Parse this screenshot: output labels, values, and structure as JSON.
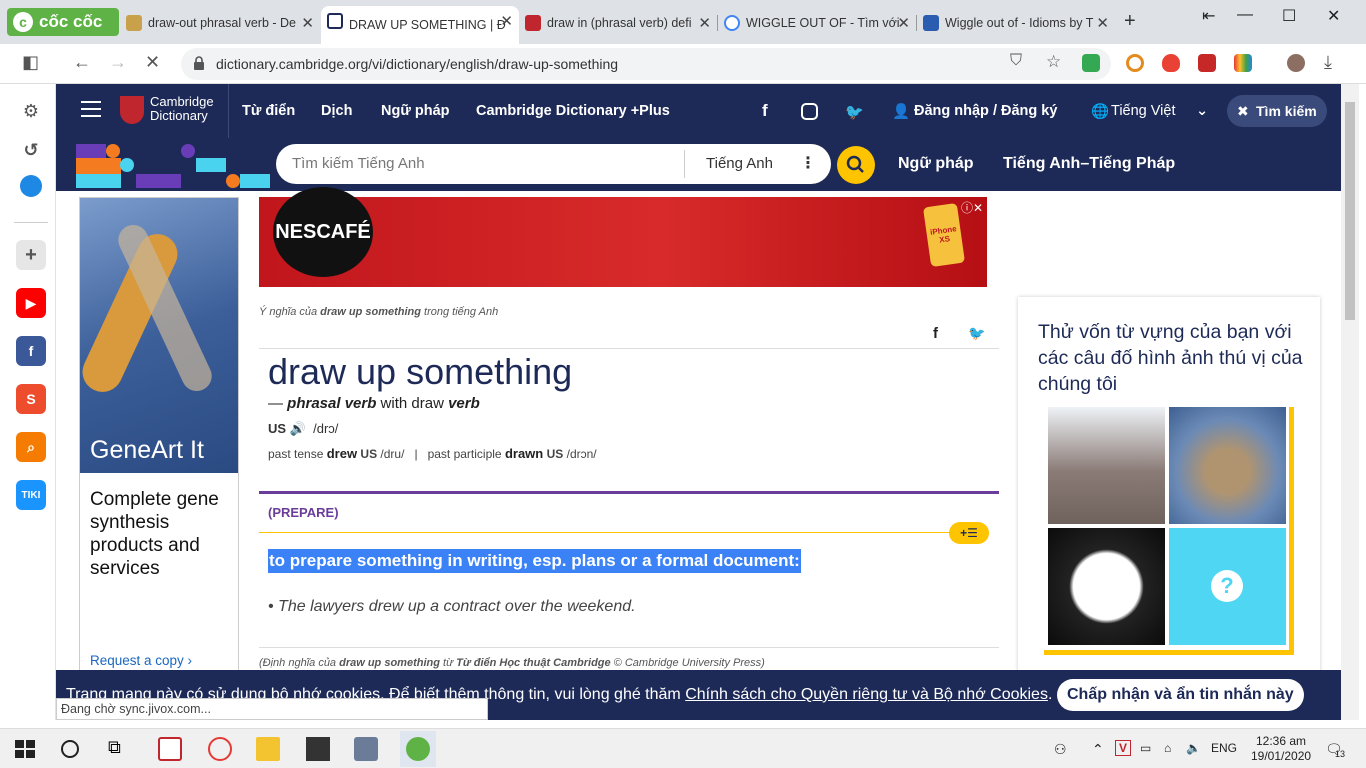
{
  "browser": {
    "logo": "cốc cốc",
    "tabs": [
      {
        "title": "draw-out phrasal verb - De",
        "favicon_color": "#8a6d3b"
      },
      {
        "title": "DRAW UP SOMETHING | Đ",
        "favicon_color": "#1d2a57"
      },
      {
        "title": "draw in (phrasal verb) defi",
        "favicon_color": "#c0262d"
      },
      {
        "title": "WIGGLE OUT OF - Tìm với",
        "favicon_color": "#4285f4"
      },
      {
        "title": "Wiggle out of - Idioms by T",
        "favicon_color": "#2a5db0"
      }
    ],
    "url": "dictionary.cambridge.org/vi/dictionary/english/draw-up-something",
    "status_text": "Đang chờ sync.jivox.com..."
  },
  "site": {
    "logo_line1": "Cambridge",
    "logo_line2": "Dictionary",
    "nav": [
      "Từ điển",
      "Dịch",
      "Ngữ pháp",
      "Cambridge Dictionary +Plus"
    ],
    "login": "Đăng nhập / Đăng ký",
    "language": "Tiếng Việt",
    "search_button": "Tìm kiếm",
    "search_placeholder": "Tìm kiếm Tiếng Anh",
    "search_lang": "Tiếng Anh",
    "sub_links": [
      "Ngữ pháp",
      "Tiếng Anh–Tiếng Pháp"
    ]
  },
  "ads": {
    "left_title": "GeneArt It",
    "left_text": "Complete gene synthesis products and services",
    "left_link": "Request a copy ›",
    "top_brand": "NESCAFÉ",
    "top_phone_label": "iPhone XS"
  },
  "entry": {
    "breadcrumb_prefix": "Ý nghĩa của ",
    "breadcrumb_word": "draw up something",
    "breadcrumb_suffix": " trong tiếng Anh",
    "headword": "draw up something",
    "pos_dash": "— ",
    "pos": "phrasal verb",
    "pos_with": " with draw ",
    "pos_verb": "verb",
    "region_us": "US",
    "ipa": "/drɔ/",
    "past_tense_label": "past tense",
    "past_tense_word": "drew",
    "past_tense_ipa": "/dru/",
    "past_participle_label": "past participle",
    "past_participle_word": "drawn",
    "past_participle_ipa": "/drɔn/",
    "guideword": "(PREPARE)",
    "definition": "to prepare something in writing, esp. plans or a formal document:",
    "example": "The lawyers drew up a contract over the weekend.",
    "footnote_prefix": "(Định nghĩa của ",
    "footnote_word": "draw up something",
    "footnote_mid": " từ ",
    "footnote_source": "Từ điển Học thuật Cambridge",
    "footnote_suffix": " © Cambridge University Press)"
  },
  "quiz": {
    "text": "Thử vốn từ vựng của bạn với các câu đố hình ảnh thú vị của chúng tôi",
    "question_mark": "?"
  },
  "cookie": {
    "text_prefix": "Trang mạng này có sử dụng bộ nhớ cookies. Để biết thêm thông tin, vui lòng ghé thăm ",
    "link": "Chính sách cho Quyền riêng tư và Bộ nhớ Cookies",
    "text_suffix": ".",
    "button": "Chấp nhận và ẩn tin nhắn này"
  },
  "taskbar": {
    "lang": "ENG",
    "time": "12:36 am",
    "date": "19/01/2020",
    "notification_count": "13"
  }
}
